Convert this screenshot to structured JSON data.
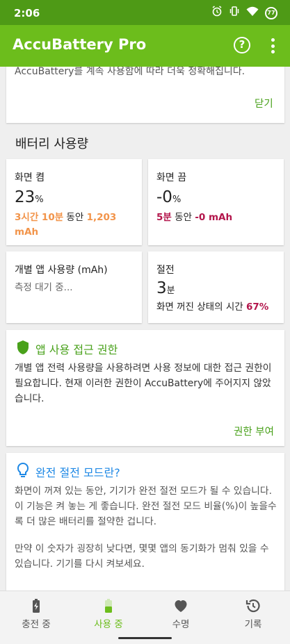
{
  "status_bar": {
    "time": "2:06",
    "battery_percent": "77",
    "icons": [
      "alarm-icon",
      "vibrate-icon",
      "wifi-icon",
      "battery-icon"
    ]
  },
  "app_bar": {
    "title": "AccuBattery Pro",
    "help_icon_glyph": "?",
    "icons": [
      "help-icon",
      "more-vert-icon"
    ]
  },
  "intro_card": {
    "text": "AccuBattery를 계속 사용함에 따라 더욱 정확해집니다.",
    "close_label": "닫기"
  },
  "battery_usage": {
    "title": "배터리 사용량",
    "screen_on": {
      "label": "화면 켬",
      "value": "23",
      "unit": "%",
      "duration": "3시간 10분",
      "during": " 동안 ",
      "mah_value": "1,203",
      "mah_unit": "mAh"
    },
    "screen_off": {
      "label": "화면 끔",
      "value": "-0",
      "unit": "%",
      "duration": "5분",
      "during": " 동안 ",
      "mah": "-0 mAh"
    },
    "per_app": {
      "label": "개별 앱 사용량 (mAh)",
      "status": "측정 대기 중..."
    },
    "deep_sleep": {
      "label": "절전",
      "value": "3",
      "unit": "분",
      "detail": "화면 꺼진 상태의 시간 ",
      "percent": "67%"
    }
  },
  "permission_card": {
    "title": "앱 사용 접근 권한",
    "body": "개별 앱 전력 사용량을 사용하려면 사용 정보에 대한 접근 권한이 필요합니다. 현재 이러한 권한이 AccuBattery에 주어지지 않았습니다.",
    "grant_label": "권한 부여"
  },
  "deep_sleep_info": {
    "title": "완전 절전 모드란?",
    "para1": "화면이 꺼져 있는 동안, 기기가 완전 절전 모드가 될 수 있습니다. 이 기능은 켜 놓는 게 좋습니다. 완전 절전 모드 비율(%)이 높을수록 더 많은 배터리를 절약한 겁니다.",
    "para2": "만약 이 숫자가 굉장히 낮다면, 몇몇 앱의 동기화가 멈춰 있을 수 있습니다. 기기를 다시 켜보세요."
  },
  "bottom_nav": {
    "items": [
      {
        "label": "충전 중",
        "icon": "charging-battery-icon"
      },
      {
        "label": "사용 중",
        "icon": "discharging-battery-icon"
      },
      {
        "label": "수명",
        "icon": "heart-icon"
      },
      {
        "label": "기록",
        "icon": "history-icon"
      }
    ],
    "active_index": 1
  },
  "colors": {
    "status_bar": "#4e9a16",
    "app_bar": "#6cbd1c",
    "accent_green": "#49a11b",
    "orange": "#f2944a",
    "crimson": "#b3154b",
    "info_blue": "#1e88e5"
  }
}
